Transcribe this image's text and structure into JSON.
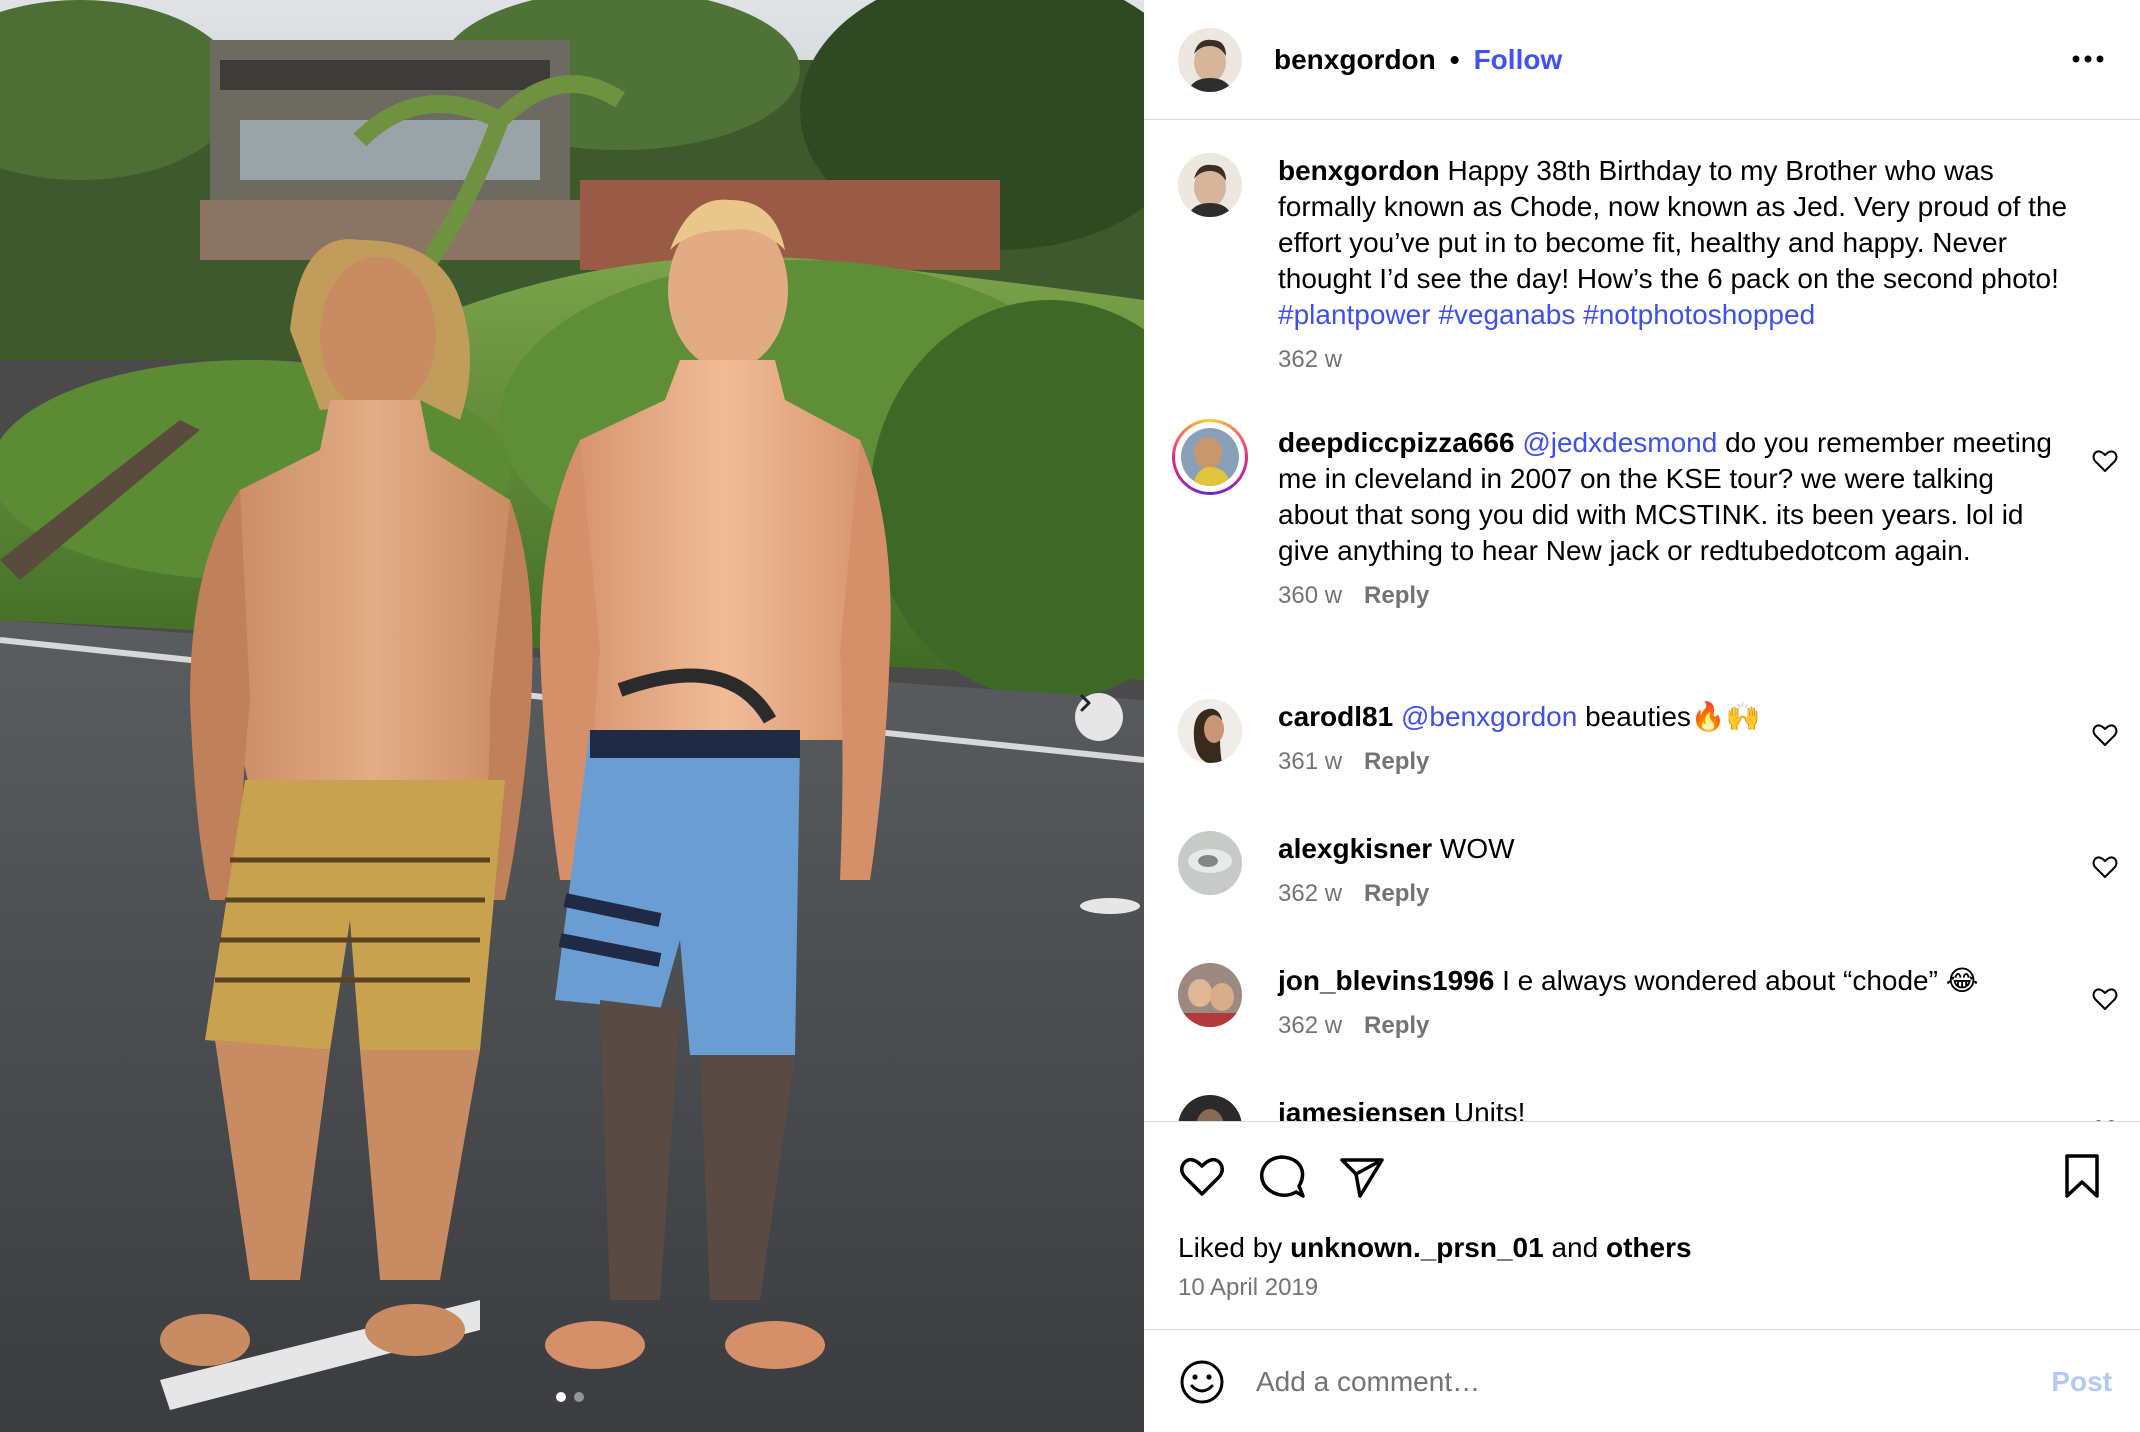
{
  "header": {
    "username": "benxgordon",
    "separator": "•",
    "follow_label": "Follow",
    "more_icon": "more-horizontal-icon"
  },
  "caption": {
    "username": "benxgordon",
    "text": "Happy 38th Birthday to my Brother who was formally known as Chode, now known as Jed. Very proud of the effort you’ve put in to become fit, healthy and happy. Never thought I’d see the day! How’s the 6 pack on the second photo!",
    "hashtags": [
      "#plantpower",
      "#veganabs",
      "#notphotoshopped"
    ],
    "time": "362 w"
  },
  "comments": [
    {
      "username": "deepdiccpizza666",
      "mention": "@jedxdesmond",
      "text": "do you remember meeting me in cleveland in 2007 on the KSE tour? we were talking about that song you did with MCSTINK. its been years. lol id give anything to hear New jack or redtubedotcom again.",
      "time": "360 w",
      "reply": "Reply"
    },
    {
      "username": "carodl81",
      "mention": "@benxgordon",
      "text": "beauties🔥🙌",
      "time": "361 w",
      "reply": "Reply"
    },
    {
      "username": "alexgkisner",
      "mention": "",
      "text": "WOW",
      "time": "362 w",
      "reply": "Reply"
    },
    {
      "username": "jon_blevins1996",
      "mention": "",
      "text": "I e always wondered about “chode” 😂",
      "time": "362 w",
      "reply": "Reply"
    },
    {
      "username": "jamesjensen",
      "mention": "",
      "text": "Units!",
      "time": "",
      "reply": ""
    }
  ],
  "actions": {
    "like_icon": "heart-icon",
    "comment_icon": "comment-bubble-icon",
    "share_icon": "send-icon",
    "save_icon": "bookmark-icon"
  },
  "likes": {
    "prefix": "Liked by",
    "user": "unknown._prsn_01",
    "middle": "and",
    "others": "others"
  },
  "date": "10 April 2019",
  "add_comment": {
    "placeholder": "Add a comment…",
    "post_label": "Post",
    "emoji_icon": "smiley-icon"
  },
  "carousel": {
    "current": 1,
    "total": 2,
    "next_icon": "chevron-right-icon"
  },
  "colors": {
    "link": "#3e4ff0",
    "follow": "#4150f7",
    "muted": "#737373",
    "post_disabled": "#b3c9f7",
    "divider": "#dbdbdb"
  }
}
